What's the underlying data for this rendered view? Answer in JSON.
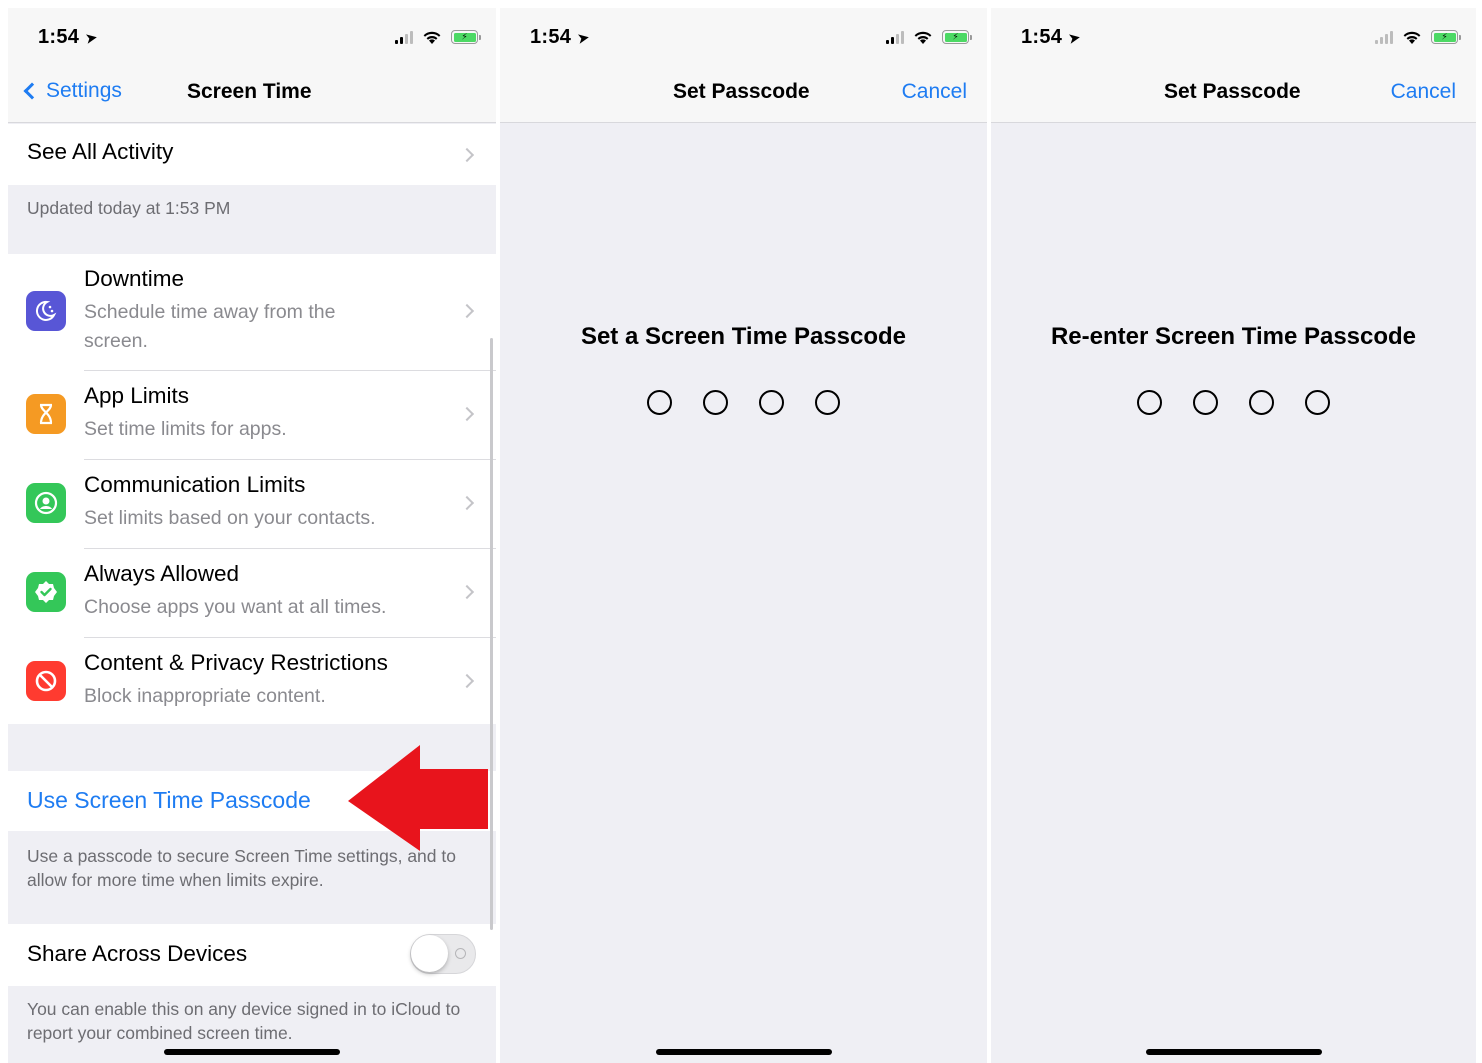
{
  "status_bar": {
    "time": "1:54",
    "location_glyph": "➤"
  },
  "screens": [
    {
      "nav": {
        "back_label": "Settings",
        "title": "Screen Time"
      },
      "see_all": {
        "label": "See All Activity",
        "footer": "Updated today at 1:53 PM"
      },
      "rows": [
        {
          "title": "Downtime",
          "subtitle": "Schedule time away from the screen.",
          "icon": "moon-clock-icon",
          "color": "#5856d6"
        },
        {
          "title": "App Limits",
          "subtitle": "Set time limits for apps.",
          "icon": "hourglass-icon",
          "color": "#f59a23"
        },
        {
          "title": "Communication Limits",
          "subtitle": "Set limits based on your contacts.",
          "icon": "person-circle-icon",
          "color": "#34c759"
        },
        {
          "title": "Always Allowed",
          "subtitle": "Choose apps you want at all times.",
          "icon": "check-badge-icon",
          "color": "#34c759"
        },
        {
          "title": "Content & Privacy Restrictions",
          "subtitle": "Block inappropriate content.",
          "icon": "no-entry-icon",
          "color": "#ff3b30"
        }
      ],
      "passcode_row": {
        "label": "Use Screen Time Passcode",
        "footer": "Use a passcode to secure Screen Time settings, and to allow for more time when limits expire."
      },
      "share_row": {
        "label": "Share Across Devices",
        "toggle_on": false,
        "footer": "You can enable this on any device signed in to iCloud to report your combined screen time."
      },
      "annotation": {
        "arrow_color": "#e8141c"
      }
    },
    {
      "nav": {
        "title": "Set Passcode",
        "cancel_label": "Cancel"
      },
      "prompt": "Set a Screen Time Passcode",
      "digits_entered": 0
    },
    {
      "nav": {
        "title": "Set Passcode",
        "cancel_label": "Cancel"
      },
      "prompt": "Re-enter Screen Time Passcode",
      "digits_entered": 0
    }
  ],
  "colors": {
    "link_blue": "#1e7cf2",
    "group_bg": "#efeff4",
    "secondary_text": "#8a8a8f",
    "footer_text": "#6d6d72"
  }
}
